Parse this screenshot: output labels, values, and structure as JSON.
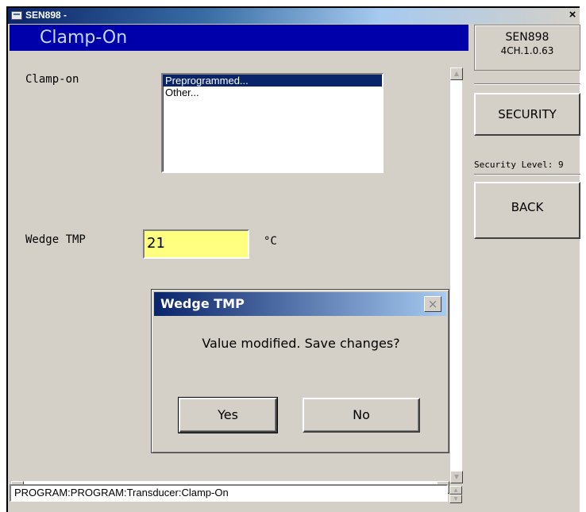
{
  "window": {
    "title": "SEN898 -",
    "close_glyph": "×"
  },
  "main": {
    "header": "Clamp-On",
    "clamp_on_label": "Clamp-on",
    "clamp_on_options": [
      "Preprogrammed...",
      "Other..."
    ],
    "clamp_on_selected": "Preprogrammed...",
    "wedge_tmp_label": "Wedge TMP",
    "wedge_tmp_value": "21",
    "wedge_tmp_unit": "°C"
  },
  "dialog": {
    "title": "Wedge TMP",
    "message": "Value modified. Save changes?",
    "yes_label": "Yes",
    "no_label": "No",
    "close_glyph": "×"
  },
  "status": {
    "path": "PROGRAM:PROGRAM:Transducer:Clamp-On"
  },
  "side": {
    "model": "SEN898",
    "version": "4CH.1.0.63",
    "security_label": "SECURITY",
    "security_level": "Security Level: 9",
    "back_label": "BACK"
  },
  "icons": {
    "window": "app-window-icon",
    "scroll_up": "scroll-up-arrow-icon",
    "scroll_down": "scroll-down-arrow-icon",
    "scroll_left": "scroll-left-arrow-icon",
    "scroll_right": "scroll-right-arrow-icon"
  },
  "colors": {
    "header_bg": "#0000aa",
    "input_bg": "#ffff80",
    "selection_bg": "#0a246a",
    "face": "#d4d0c8"
  }
}
